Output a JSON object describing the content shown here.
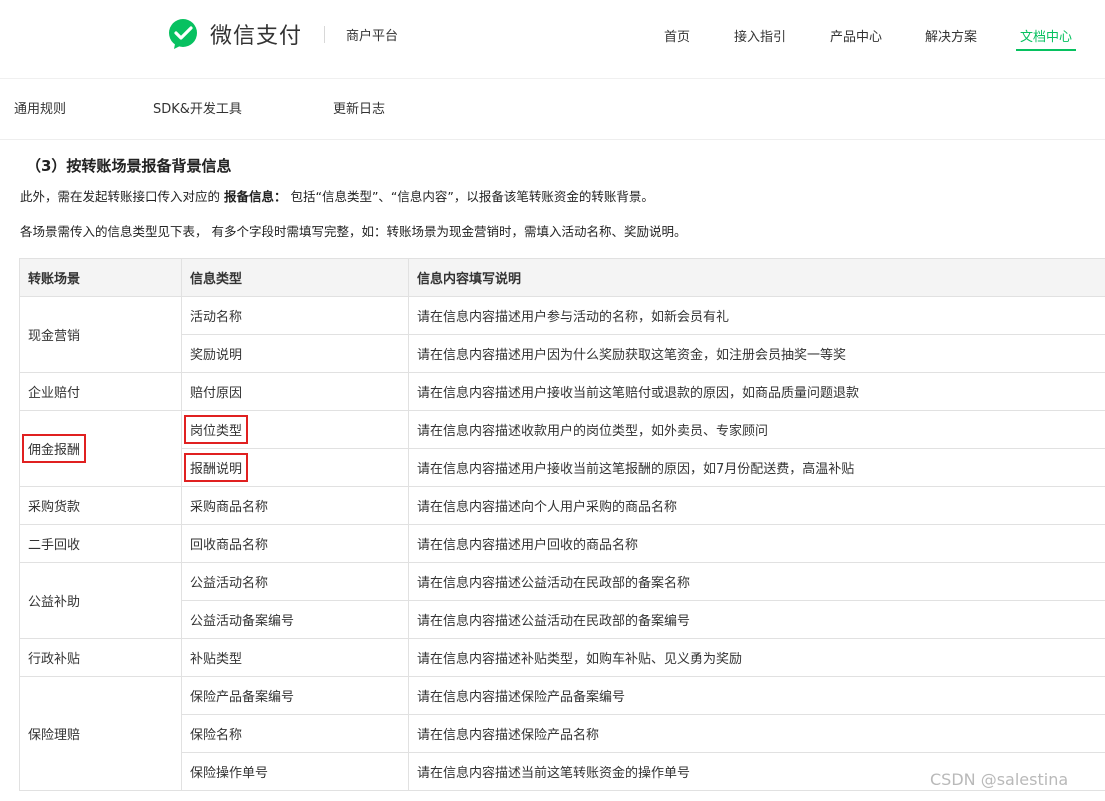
{
  "header": {
    "logo_text": "微信支付",
    "platform_label": "商户平台",
    "nav": [
      "首页",
      "接入指引",
      "产品中心",
      "解决方案",
      "文档中心"
    ],
    "active_nav": "文档中心",
    "accent_color": "#07c160"
  },
  "subnav": [
    "通用规则",
    "SDK&开发工具",
    "更新日志"
  ],
  "content": {
    "section_title": "（3）按转账场景报备背景信息",
    "para1_prefix": "此外，需在发起转账接口传入对应的 ",
    "para1_bold": "报备信息：",
    "para1_suffix": " 包括“信息类型”、“信息内容”，以报备该笔转账资金的转账背景。",
    "para2": "各场景需传入的信息类型见下表，  有多个字段时需填写完整，如：转账场景为现金营销时，需填入活动名称、奖励说明。"
  },
  "table": {
    "headers": [
      "转账场景",
      "信息类型",
      "信息内容填写说明"
    ],
    "groups": [
      {
        "scene": "现金营销",
        "rows": [
          {
            "type": "活动名称",
            "desc": "请在信息内容描述用户参与活动的名称，如新会员有礼"
          },
          {
            "type": "奖励说明",
            "desc": "请在信息内容描述用户因为什么奖励获取这笔资金，如注册会员抽奖一等奖"
          }
        ]
      },
      {
        "scene": "企业赔付",
        "rows": [
          {
            "type": "赔付原因",
            "desc": "请在信息内容描述用户接收当前这笔赔付或退款的原因，如商品质量问题退款"
          }
        ]
      },
      {
        "scene": "佣金报酬",
        "rows": [
          {
            "type": "岗位类型",
            "desc": "请在信息内容描述收款用户的岗位类型，如外卖员、专家顾问"
          },
          {
            "type": "报酬说明",
            "desc": "请在信息内容描述用户接收当前这笔报酬的原因，如7月份配送费，高温补贴"
          }
        ]
      },
      {
        "scene": "采购货款",
        "rows": [
          {
            "type": "采购商品名称",
            "desc": "请在信息内容描述向个人用户采购的商品名称"
          }
        ]
      },
      {
        "scene": "二手回收",
        "rows": [
          {
            "type": "回收商品名称",
            "desc": "请在信息内容描述用户回收的商品名称"
          }
        ]
      },
      {
        "scene": "公益补助",
        "rows": [
          {
            "type": "公益活动名称",
            "desc": "请在信息内容描述公益活动在民政部的备案名称"
          },
          {
            "type": "公益活动备案编号",
            "desc": "请在信息内容描述公益活动在民政部的备案编号"
          }
        ]
      },
      {
        "scene": "行政补贴",
        "rows": [
          {
            "type": "补贴类型",
            "desc": "请在信息内容描述补贴类型，如购车补贴、见义勇为奖励"
          }
        ]
      },
      {
        "scene": "保险理赔",
        "rows": [
          {
            "type": "保险产品备案编号",
            "desc": "请在信息内容描述保险产品备案编号"
          },
          {
            "type": "保险名称",
            "desc": "请在信息内容描述保险产品名称"
          },
          {
            "type": "保险操作单号",
            "desc": "请在信息内容描述当前这笔转账资金的操作单号"
          }
        ]
      }
    ],
    "highlight_color": "#e02020"
  },
  "watermark": "CSDN @salestina"
}
